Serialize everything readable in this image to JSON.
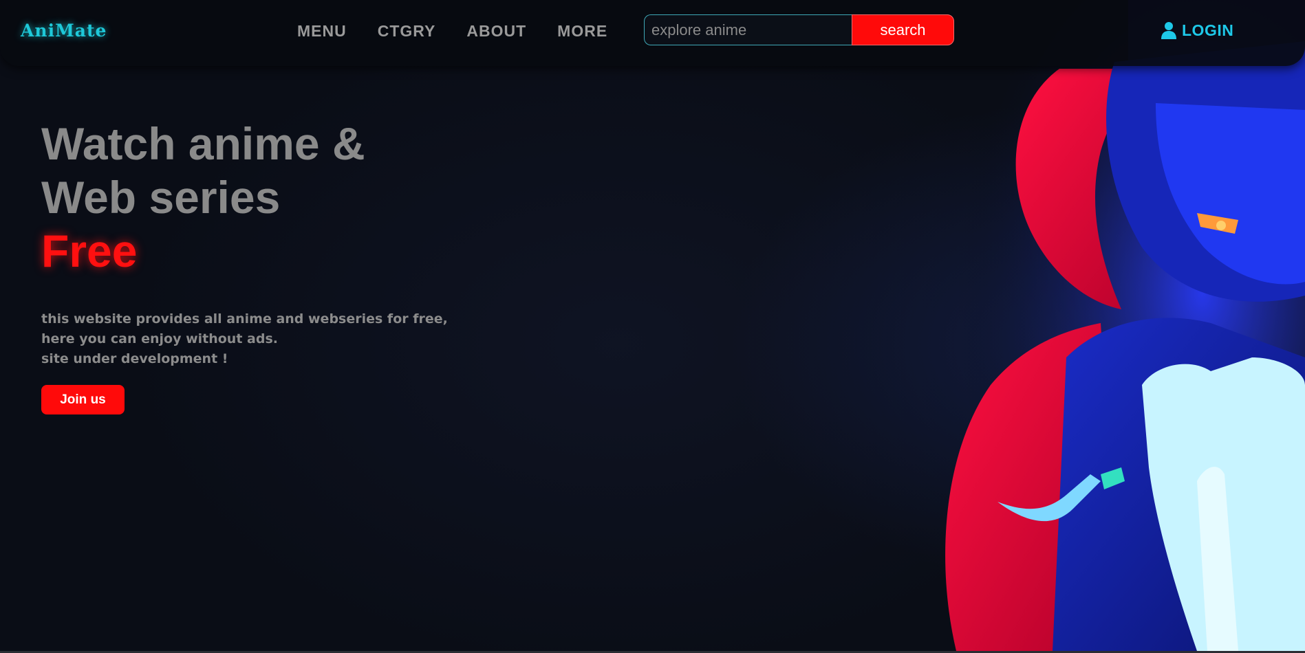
{
  "brand": {
    "logo_text": "AniMate"
  },
  "nav": {
    "links": [
      "MENU",
      "CTGRY",
      "ABOUT",
      "MORE"
    ]
  },
  "search": {
    "placeholder": "explore anime",
    "button_label": "search"
  },
  "login": {
    "label": "LOGIN",
    "icon": "user-icon"
  },
  "hero": {
    "headline_line1": "Watch anime &",
    "headline_line2": "Web series",
    "headline_accent": "Free",
    "description": [
      "this website provides all anime and webseries for free,",
      "here you can enjoy without ads.",
      "site under development !"
    ],
    "cta_label": "Join us"
  },
  "colors": {
    "background": "#0a0d16",
    "accent_red": "#ff0a0a",
    "accent_cyan": "#1ec8e8",
    "muted_text": "#8a8a8a"
  }
}
